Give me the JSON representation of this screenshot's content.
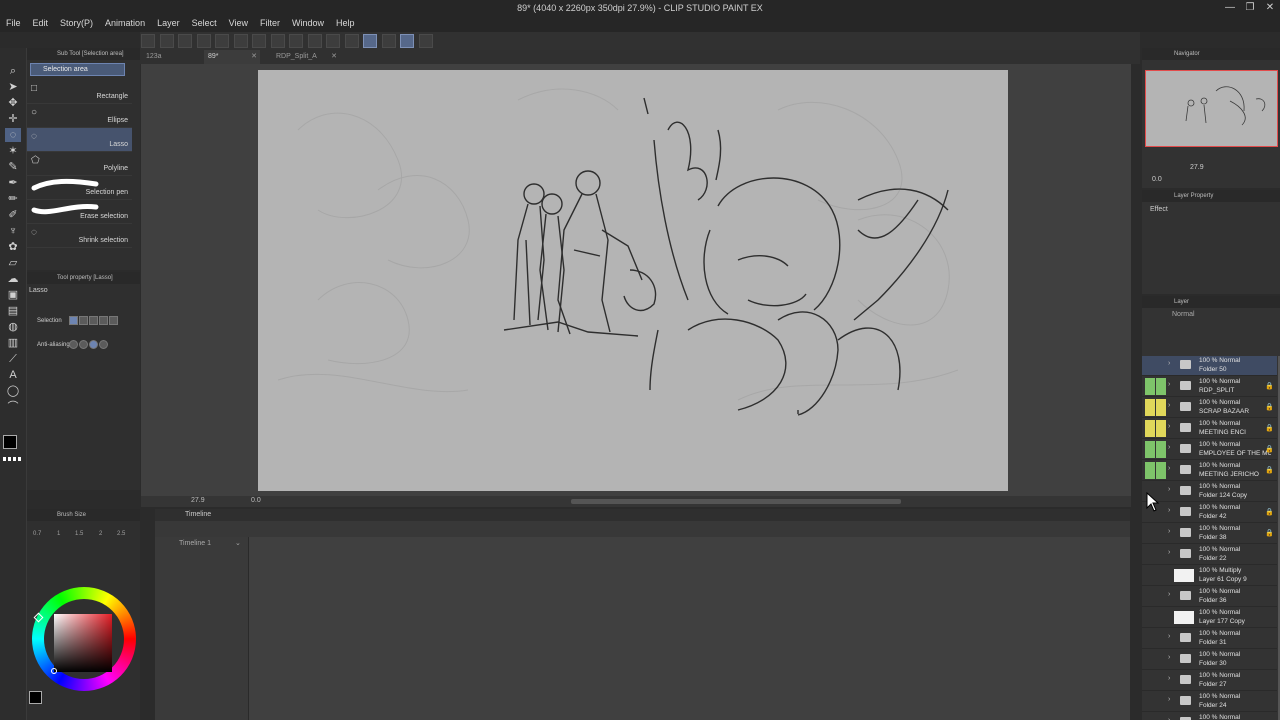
{
  "window": {
    "title": "89* (4040 x 2260px 350dpi 27.9%) - CLIP STUDIO PAINT EX"
  },
  "menu": [
    "File",
    "Edit",
    "Story(P)",
    "Animation",
    "Layer",
    "Select",
    "View",
    "Filter",
    "Window",
    "Help"
  ],
  "tabs": [
    {
      "label": "123a",
      "active": false
    },
    {
      "label": "89*",
      "active": true
    },
    {
      "label": "RDP_Split_A",
      "active": false
    }
  ],
  "subtool": {
    "title": "Sub Tool [Selection area]",
    "group": "Selection area",
    "items": [
      {
        "label": "Rectangle",
        "icon": "rectangle-icon",
        "selected": false
      },
      {
        "label": "Ellipse",
        "icon": "ellipse-icon",
        "selected": false
      },
      {
        "label": "Lasso",
        "icon": "lasso-icon",
        "selected": true
      },
      {
        "label": "Polyline",
        "icon": "polyline-icon",
        "selected": false
      },
      {
        "label": "Selection pen",
        "icon": "selection-pen-icon",
        "selected": false
      },
      {
        "label": "Erase selection",
        "icon": "erase-selection-icon",
        "selected": false
      },
      {
        "label": "Shrink selection",
        "icon": "shrink-selection-icon",
        "selected": false
      }
    ]
  },
  "toolprop": {
    "title": "Tool property [Lasso]",
    "tool_name": "Lasso",
    "selection_label": "Selection",
    "antialias_label": "Anti-aliasing"
  },
  "brushsize": {
    "title": "Brush Size",
    "sizes": [
      "0.7",
      "1",
      "1.5",
      "2",
      "2.5"
    ]
  },
  "canvas_status": {
    "zoom": "27.9",
    "angle": "0.0"
  },
  "timeline": {
    "title": "Timeline",
    "name": "Timeline 1"
  },
  "navigator": {
    "title": "Navigator",
    "zoom": "27.9",
    "angle": "0.0"
  },
  "layer_property": {
    "title": "Layer Property",
    "effect_label": "Effect"
  },
  "layers": {
    "title": "Layer",
    "blend_mode": "Normal",
    "rows": [
      {
        "mode": "100 % Normal",
        "name": "Folder 50",
        "type": "folder",
        "selected": true,
        "locked": false,
        "color": "",
        "visible": true
      },
      {
        "mode": "100 % Normal",
        "name": "RDP_SPLIT",
        "type": "folder",
        "selected": false,
        "locked": true,
        "color": "#7ec46a",
        "visible": false
      },
      {
        "mode": "100 % Normal",
        "name": "SCRAP BAZAAR",
        "type": "folder",
        "selected": false,
        "locked": true,
        "color": "#e0d75a",
        "visible": false
      },
      {
        "mode": "100 % Normal",
        "name": "MEETING ENCI",
        "type": "folder",
        "selected": false,
        "locked": true,
        "color": "#e0d75a",
        "visible": false
      },
      {
        "mode": "100 % Normal",
        "name": "EMPLOYEE OF THE MO",
        "type": "folder",
        "selected": false,
        "locked": true,
        "color": "#7ec46a",
        "visible": false
      },
      {
        "mode": "100 % Normal",
        "name": "MEETING JERICHO",
        "type": "folder",
        "selected": false,
        "locked": true,
        "color": "#7ec46a",
        "visible": false
      },
      {
        "mode": "100 % Normal",
        "name": "Folder 124 Copy",
        "type": "folder",
        "selected": false,
        "locked": false,
        "color": "",
        "visible": true
      },
      {
        "mode": "100 % Normal",
        "name": "Folder 42",
        "type": "folder",
        "selected": false,
        "locked": true,
        "color": "",
        "visible": false
      },
      {
        "mode": "100 % Normal",
        "name": "Folder 38",
        "type": "folder",
        "selected": false,
        "locked": true,
        "color": "",
        "visible": false
      },
      {
        "mode": "100 % Normal",
        "name": "Folder 22",
        "type": "folder",
        "selected": false,
        "locked": false,
        "color": "",
        "visible": false
      },
      {
        "mode": "100 % Multiply",
        "name": "Layer 61 Copy 9",
        "type": "layer",
        "selected": false,
        "locked": false,
        "color": "",
        "visible": false
      },
      {
        "mode": "100 % Normal",
        "name": "Folder 36",
        "type": "folder",
        "selected": false,
        "locked": false,
        "color": "",
        "visible": false
      },
      {
        "mode": "100 % Normal",
        "name": "Layer 177 Copy",
        "type": "layer",
        "selected": false,
        "locked": false,
        "color": "",
        "visible": false
      },
      {
        "mode": "100 % Normal",
        "name": "Folder 31",
        "type": "folder",
        "selected": false,
        "locked": false,
        "color": "",
        "visible": false
      },
      {
        "mode": "100 % Normal",
        "name": "Folder 30",
        "type": "folder",
        "selected": false,
        "locked": false,
        "color": "",
        "visible": false
      },
      {
        "mode": "100 % Normal",
        "name": "Folder 27",
        "type": "folder",
        "selected": false,
        "locked": false,
        "color": "",
        "visible": false
      },
      {
        "mode": "100 % Normal",
        "name": "Folder 24",
        "type": "folder",
        "selected": false,
        "locked": false,
        "color": "",
        "visible": false
      },
      {
        "mode": "100 % Normal",
        "name": "",
        "type": "folder",
        "selected": false,
        "locked": false,
        "color": "",
        "visible": false
      }
    ]
  },
  "colors": {
    "accent": "#6d84b1",
    "canvas": "#b4b4b4",
    "panel": "#2f2f2f"
  }
}
